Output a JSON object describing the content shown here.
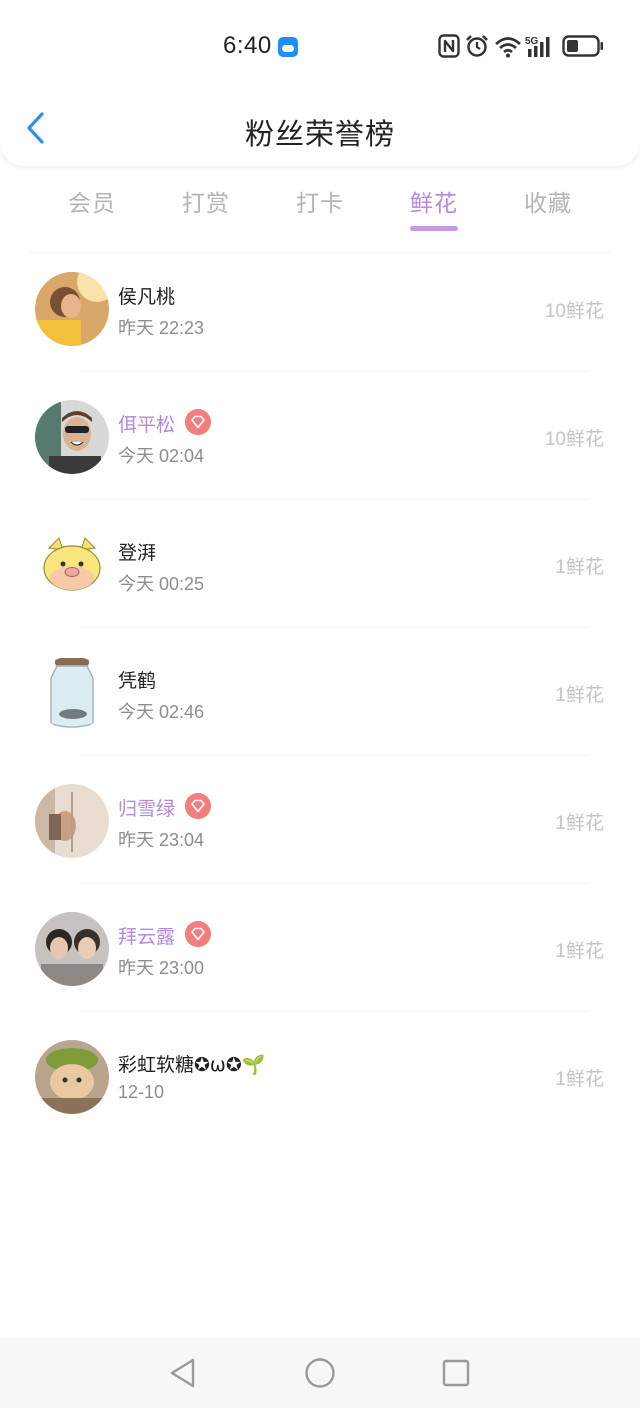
{
  "status_bar": {
    "time": "6:40",
    "weather_icon": "weather-cloud-icon",
    "icons": [
      "nfc-icon",
      "alarm-icon",
      "wifi-icon",
      "5g-signal-icon",
      "battery-icon"
    ],
    "network_label": "5G"
  },
  "header": {
    "back_icon": "chevron-left-icon",
    "title": "粉丝荣誉榜"
  },
  "tabs": [
    {
      "label": "会员",
      "active": false
    },
    {
      "label": "打赏",
      "active": false
    },
    {
      "label": "打卡",
      "active": false
    },
    {
      "label": "鲜花",
      "active": true
    },
    {
      "label": "收藏",
      "active": false
    }
  ],
  "fans": [
    {
      "name": "侯凡桃",
      "vip": false,
      "time": "昨天 22:23",
      "count": "10鲜花"
    },
    {
      "name": "佴平松",
      "vip": true,
      "time": "今天 02:04",
      "count": "10鲜花"
    },
    {
      "name": "登湃",
      "vip": false,
      "time": "今天 00:25",
      "count": "1鲜花"
    },
    {
      "name": "凭鹤",
      "vip": false,
      "time": "今天 02:46",
      "count": "1鲜花"
    },
    {
      "name": "归雪绿",
      "vip": true,
      "time": "昨天 23:04",
      "count": "1鲜花"
    },
    {
      "name": "拜云露",
      "vip": true,
      "time": "昨天 23:00",
      "count": "1鲜花"
    },
    {
      "name": "彩虹软糖✪ω✪🌱",
      "vip": false,
      "time": "12-10",
      "count": "1鲜花"
    }
  ],
  "nav": {
    "back": "triangle-back-icon",
    "home": "circle-home-icon",
    "recents": "square-recents-icon"
  },
  "colors": {
    "accent": "#b687e3",
    "vip_name": "#b488dc",
    "vip_badge": "#f27e7e",
    "back_arrow": "#2e8ee8"
  }
}
